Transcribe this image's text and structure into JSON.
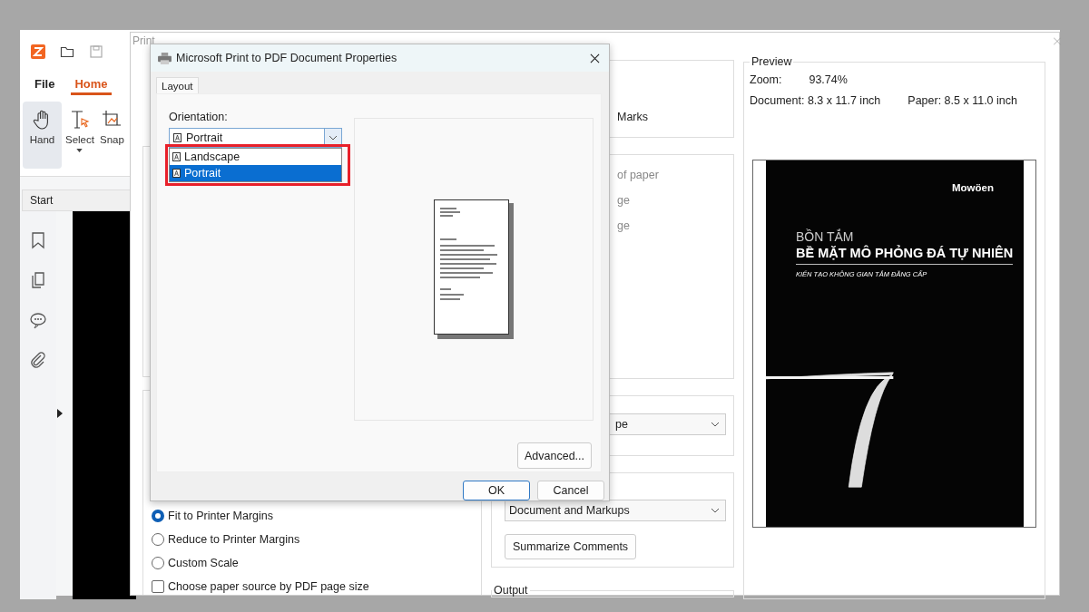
{
  "app": {
    "menu_tabs": [
      {
        "label": "File",
        "selected": false
      },
      {
        "label": "Home",
        "selected": true
      }
    ],
    "ribbon": [
      {
        "kind": "hand",
        "label": "Hand",
        "selected": true,
        "dropdown": false
      },
      {
        "kind": "select",
        "label": "Select",
        "selected": false,
        "dropdown": true
      },
      {
        "kind": "snapshot",
        "label": "Snap",
        "selected": false,
        "dropdown": false
      }
    ],
    "document_tab": "Start"
  },
  "print_dialog": {
    "title": "Print",
    "marks_label": "Marks",
    "page_texts": [
      "of paper",
      "ge",
      "ge"
    ],
    "orientation_select": "pe",
    "comments_select": "Document and Markups",
    "summarize_button": "Summarize Comments",
    "output_label": "Output",
    "scale_options": [
      {
        "label": "Fit to Printer Margins",
        "selected": true
      },
      {
        "label": "Reduce to Printer Margins",
        "selected": false
      },
      {
        "label": "Custom Scale",
        "selected": false
      }
    ],
    "paper_source": {
      "label": "Choose paper source by PDF page size",
      "checked": false
    },
    "preview": {
      "title": "Preview",
      "zoom_label": "Zoom:",
      "zoom_value": "93.74%",
      "document_size": "Document: 8.3 x 11.7 inch",
      "paper_size": "Paper: 8.5 x 11.0 inch",
      "page": {
        "brand": "Mowöen",
        "kicker": "BỒN TẮM",
        "headline": "BỀ MẶT MÔ PHỎNG ĐÁ TỰ NHIÊN",
        "tagline": "KIẾN TẠO KHÔNG GIAN TẮM ĐẲNG CẤP"
      }
    }
  },
  "properties_dialog": {
    "title": "Microsoft Print to PDF Document Properties",
    "tabs": [
      {
        "label": "Layout",
        "selected": true
      }
    ],
    "orientation_label": "Orientation:",
    "orientation_value": "Portrait",
    "orientation_options": [
      {
        "label": "Landscape",
        "selected": false
      },
      {
        "label": "Portrait",
        "selected": true
      }
    ],
    "advanced_button": "Advanced...",
    "buttons": [
      {
        "label": "OK",
        "default": true
      },
      {
        "label": "Cancel",
        "default": false
      }
    ]
  }
}
